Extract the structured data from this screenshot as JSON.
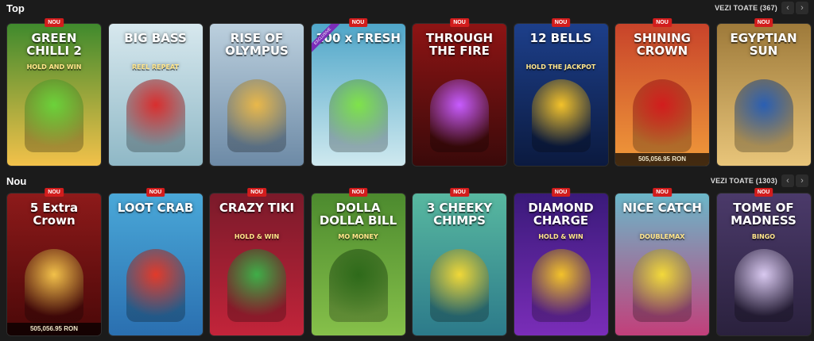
{
  "sections": [
    {
      "title": "Top",
      "see_all": "VEZI TOATE (367)",
      "games": [
        {
          "title": "GREEN CHILLI 2",
          "sub": "HOLD AND WIN",
          "badge": "NOU",
          "bg": "#3f8a2d",
          "bg2": "#f2c14a",
          "accent": "#6cd23a"
        },
        {
          "title": "BIG BASS",
          "sub": "REEL REPEAT",
          "badge": "",
          "bg": "#d7e8ee",
          "bg2": "#8fb8c6",
          "accent": "#d92e2e"
        },
        {
          "title": "RISE OF OLYMPUS",
          "sub": "",
          "badge": "",
          "bg": "#bcd0de",
          "bg2": "#6d8aa6",
          "accent": "#e9b84a"
        },
        {
          "title": "100 x FRESH",
          "sub": "",
          "badge": "NOU",
          "bg": "#4fa6c9",
          "bg2": "#cfe9ef",
          "accent": "#7fe34a",
          "ribbon": "EXCLUSIVE"
        },
        {
          "title": "THROUGH THE FIRE",
          "sub": "",
          "badge": "NOU",
          "bg": "#8d1414",
          "bg2": "#3a0a0a",
          "accent": "#c75cff"
        },
        {
          "title": "12 BELLS",
          "sub": "HOLD THE JACKPOT",
          "badge": "NOU",
          "bg": "#1d3f8a",
          "bg2": "#0b1a3f",
          "accent": "#f3c22a"
        },
        {
          "title": "SHINING CROWN",
          "sub": "",
          "badge": "NOU",
          "bg": "#c8432a",
          "bg2": "#f09a3a",
          "accent": "#d21d1d",
          "jackpot": "505,056.95 RON"
        },
        {
          "title": "EGYPTIAN SUN",
          "sub": "",
          "badge": "NOU",
          "bg": "#9e7a3a",
          "bg2": "#e8c57a",
          "accent": "#2a5fb3"
        }
      ]
    },
    {
      "title": "Nou",
      "see_all": "VEZI TOATE (1303)",
      "games": [
        {
          "title": "5 Extra Crown",
          "sub": "",
          "badge": "NOU",
          "bg": "#8d1a1a",
          "bg2": "#4a0808",
          "accent": "#f2c14a",
          "jackpot": "505,056.95 RON"
        },
        {
          "title": "LOOT CRAB",
          "sub": "",
          "badge": "NOU",
          "bg": "#4aa8d8",
          "bg2": "#2a6fb0",
          "accent": "#e23a2a"
        },
        {
          "title": "CRAZY TIKI",
          "sub": "HOLD & WIN",
          "badge": "NOU",
          "bg": "#7a1a2a",
          "bg2": "#c2243a",
          "accent": "#3fae48"
        },
        {
          "title": "DOLLA DOLLA BILL",
          "sub": "MO MONEY",
          "badge": "NOU",
          "bg": "#4c8a2e",
          "bg2": "#86c04a",
          "accent": "#2e6a1a"
        },
        {
          "title": "3 CHEEKY CHIMPS",
          "sub": "",
          "badge": "NOU",
          "bg": "#58b8a0",
          "bg2": "#2c7a8a",
          "accent": "#f0d838"
        },
        {
          "title": "DIAMOND CHARGE",
          "sub": "HOLD & WIN",
          "badge": "NOU",
          "bg": "#3a1a7a",
          "bg2": "#7a2db8",
          "accent": "#f3c22a"
        },
        {
          "title": "NICE CATCH",
          "sub": "DOUBLEMAX",
          "badge": "NOU",
          "bg": "#6bb7c9",
          "bg2": "#c23f7a",
          "accent": "#f3d93a"
        },
        {
          "title": "TOME OF MADNESS",
          "sub": "BINGO",
          "badge": "NOU",
          "bg": "#4b3a6a",
          "bg2": "#2a213d",
          "accent": "#d9c9f0"
        }
      ]
    }
  ]
}
